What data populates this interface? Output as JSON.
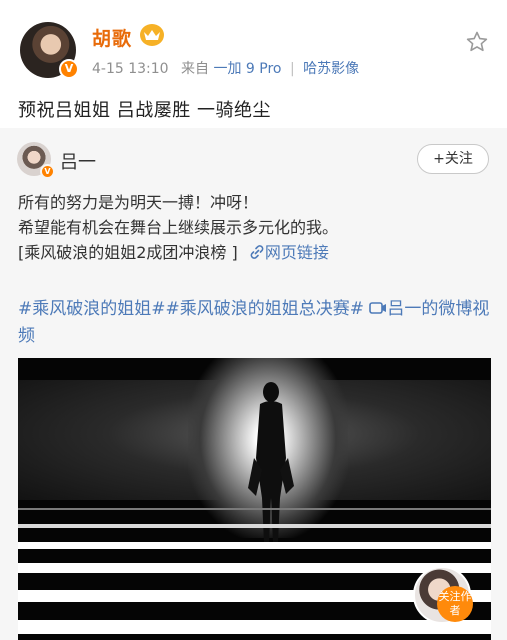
{
  "post": {
    "author": "胡歌",
    "date": "4-15 13:10",
    "source_prefix": "来自",
    "device": "一加 9 Pro",
    "device_tag": "哈苏影像",
    "separator": "|",
    "text": "预祝吕姐姐 吕战屡胜 一骑绝尘"
  },
  "repost": {
    "author": "吕一",
    "follow_label": "+关注",
    "line1": "所有的努力是为明天一搏！冲呀！",
    "line2": "希望能有机会在舞台上继续展示多元化的我。",
    "line3_prefix": "[乘风破浪的姐姐2成团冲浪榜 ]",
    "link_label": "网页链接",
    "tag1": "#乘风破浪的姐姐#",
    "tag2": "#乘风破浪的姐姐总决赛#",
    "video_link": "吕一的微博视频",
    "follow_author_label": "关注作者"
  },
  "colors": {
    "brand": "#ff8200",
    "link": "#4d7ab8",
    "username": "#e86b0a"
  }
}
